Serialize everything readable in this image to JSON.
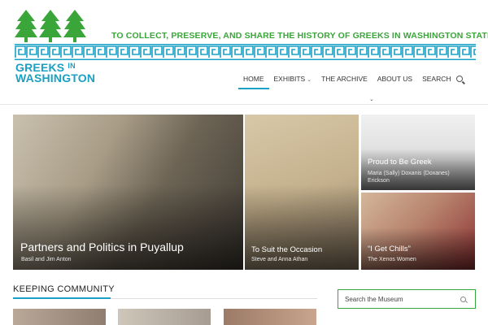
{
  "site": {
    "tagline": "TO COLLECT, PRESERVE, AND SHARE THE HISTORY OF GREEKS IN WASHINGTON STATE",
    "logo_line1": "GREEKS",
    "logo_line1_small": "IN",
    "logo_line2": "WASHINGTON",
    "brand_green": "#3aa63a",
    "brand_blue": "#1aa0c4"
  },
  "nav": {
    "items": [
      {
        "label": "HOME",
        "active": true
      },
      {
        "label": "EXHIBITS",
        "has_dropdown": true
      },
      {
        "label": "THE ARCHIVE"
      },
      {
        "label": "ABOUT US"
      },
      {
        "label": "SEARCH"
      }
    ],
    "more_glyph": "⌄"
  },
  "featured": [
    {
      "title": "Partners and Politics in Puyallup",
      "subtitle": "Basil and Jim Anton"
    },
    {
      "title": "To Suit the Occasion",
      "subtitle": "Steve and Anna Athan"
    },
    {
      "title": "Proud to Be Greek",
      "subtitle": "Maria (Sally) Doxanis (Doxanes) Erickson"
    },
    {
      "title": "“I Get Chills”",
      "subtitle": "The Xenos Women"
    }
  ],
  "section": {
    "title": "KEEPING COMMUNITY"
  },
  "museum_search": {
    "placeholder": "Search the Museum"
  }
}
